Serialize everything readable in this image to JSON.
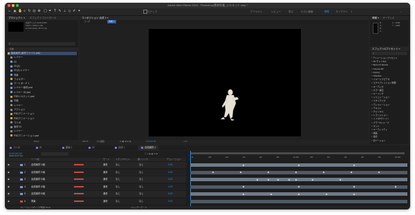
{
  "window": {
    "title": "Adobe After Effects 2024 - Photoshop素材作業_シルエット.aep *"
  },
  "workspace_tabs": [
    "デフォルト",
    "レビュー",
    "学ぶ",
    "小さい画面",
    "標準",
    "ライブラリ"
  ],
  "project_panel": {
    "tab": "プロジェクト ≡",
    "tab2": "エフェクトコントロール",
    "info_lines": [
      "合成サイズ 1920x1080",
      "1920 x 1080 (1.00)",
      "Δ 0:00:10:00, 29.97 fps"
    ],
    "search_placeholder": "ρ",
    "col_name": "名前",
    "items": [
      {
        "label": "動画素材 (素材ファイル.psd)",
        "color": "#d4a24a"
      },
      {
        "label": "レイヤー",
        "color": "#8a8a8a"
      },
      {
        "label": "03",
        "color": "#7a9ad6"
      },
      {
        "label": "03 (2)",
        "color": "#7a9ad6"
      },
      {
        "label": "03 (2) レイヤー",
        "color": "#7a9ad6"
      },
      {
        "label": "背景",
        "color": "#7a9ad6"
      },
      {
        "label": "フォルダー",
        "color": "#d4a24a"
      },
      {
        "label": "アートボード 1",
        "color": "#7a9ad6"
      },
      {
        "label": "レイヤー/素材.psd",
        "color": "#7a9ad6"
      },
      {
        "label": "レイヤー 01.psd",
        "color": "#7a9ad6"
      },
      {
        "label": "PSDシルエット.psd",
        "color": "#d4a24a"
      },
      {
        "label": "平面",
        "color": "#8a8a8a"
      },
      {
        "label": "レイヤー",
        "color": "#8a8a8a"
      },
      {
        "label": "アクション",
        "color": "#8a8a8a"
      },
      {
        "label": "PSDアニメーション",
        "color": "#d4a24a"
      },
      {
        "label": "PSDアニメーション",
        "color": "#d4a24a"
      },
      {
        "label": "コンポ",
        "color": "#8a8a8a"
      },
      {
        "label": "素材 01",
        "color": "#8a8a8a"
      },
      {
        "label": "レイヤー",
        "color": "#8a8a8a"
      },
      {
        "label": "PSDアニメーション.psd",
        "color": "#d4a24a"
      }
    ],
    "footer": "8 bpc"
  },
  "composition_panel": {
    "tab": "コンポジション 合成 1 ≡",
    "breadcrumb_left": "コンポ",
    "breadcrumb_right": "合成 1",
    "zoom": "100 %",
    "quality": "フル画質",
    "time": "0:00:00:00",
    "exposure": "+0.0"
  },
  "info_panel": {
    "tab": "情報 ≡",
    "tab2": "オーディオ",
    "lines": [
      "R :",
      "G :",
      "B :",
      "A :"
    ],
    "coords": [
      "X : 1698",
      "Y : 1088"
    ]
  },
  "effects_panel": {
    "tab": "エフェクト&プリセット ≡",
    "search_placeholder": "ρ",
    "items": [
      "* アニメーションプリセット",
      "> 3D チャンネル",
      "> Boris FX Mocha",
      "> Cinema 4D",
      "> Keying",
      "> Obsolete",
      "> イマーシブビデオ",
      "> エクスプレッション制御",
      "> オーディオ",
      "> カラー補正",
      "> キーイング",
      "> シミュレーション",
      "> スタイライズ",
      "> ディストーション",
      "> テキスト",
      "> チャンネル",
      "> トランジション",
      "> ノイズ&グレイン",
      "> ブラー&シャープ",
      "> マット",
      "> ユーティリティ",
      "> 描画",
      "> 遠近",
      "> 旧バージョン"
    ]
  },
  "timeline": {
    "tabs": [
      "コンポ",
      "01",
      "動画 1",
      "02",
      "合成 1",
      "合成素材 1"
    ],
    "timecode": "0:00:00:00",
    "fps": "00000 (29.97 fps)",
    "col_source": "ソース名",
    "col_mode": "モード",
    "col_trkmat": "トラックマット",
    "col_parent": "親とリンク",
    "col_dur": "デュレーション",
    "layers": [
      {
        "num": "1",
        "name": "合成素材 1/素",
        "mode": "通常",
        "trk": "なし",
        "parent": "なし",
        "dur": "0:00",
        "color": "#7a9ad6"
      },
      {
        "num": "2",
        "name": "合成素材 2/素",
        "mode": "通常",
        "trk": "なし",
        "parent": "なし",
        "dur": "0:00",
        "color": "#7a9ad6"
      },
      {
        "num": "3",
        "name": "合成素材 3/素",
        "mode": "通常",
        "trk": "なし",
        "parent": "なし",
        "dur": "0:00",
        "color": "#7a9ad6"
      },
      {
        "num": "4",
        "name": "合成素材 4/素",
        "mode": "通常",
        "trk": "なし",
        "parent": "なし",
        "dur": "0:00",
        "color": "#7a9ad6"
      },
      {
        "num": "5",
        "name": "合成素材 5/素",
        "mode": "通常",
        "trk": "なし",
        "parent": "なし",
        "dur": "0:00",
        "color": "#7a9ad6"
      },
      {
        "num": "6",
        "name": "背景",
        "mode": "通常",
        "trk": "なし",
        "parent": "なし",
        "dur": "0:00",
        "color": "#c94a4a"
      }
    ],
    "ruler": [
      "0f",
      "05f",
      "10f",
      "15f",
      "20f",
      "25f",
      "01:00f",
      "05f",
      "10f",
      "15f",
      "20f",
      "25f",
      "02:00f"
    ],
    "footer": "フレームレンダリング時間 16ms",
    "footer_right": "スイッチ / モード"
  },
  "colors": {
    "accent_blue": "#2d8ceb",
    "layer_bar": "#6f7a88",
    "layer_bar_alt": "#4f5a66",
    "green_track": "#4aa84a"
  }
}
